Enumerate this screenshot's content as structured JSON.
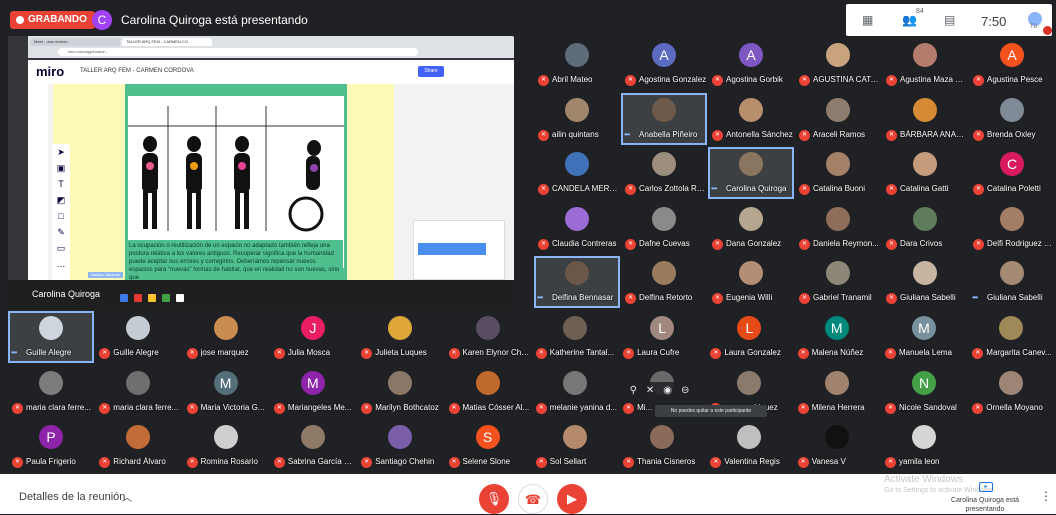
{
  "topbar": {
    "recording": "GRABANDO",
    "presenter_initial": "C",
    "presenter_title": "Carolina Quiroga está presentando",
    "time": "7:50",
    "participant_count": "84",
    "you_label": "Tú"
  },
  "presentation": {
    "tabs": [
      "Meet - una reunión",
      "TALLER ARQ FEM - CARMEN CO"
    ],
    "url": "miro.com/app/board/...",
    "app_name": "miro",
    "board": "TALLER ARQ FEM - CARMEN CORDOVA",
    "share": "Share",
    "body": "La ocupación o reutilización de un espacio no adaptado también refleja una postura relativa a los valores antiguos. Recuperar significa que la humanidad puede aceptar sus errores y corregirlos. Deberíamos repensar nuevos espacios para \"nuevas\" formas de habitar, que en realidad no son nuevas, sino que",
    "cursor_label": "Natalia Valverde",
    "presenter_name": "Carolina Quiroga"
  },
  "participants": [
    {
      "name": "Abril Mateo",
      "type": "photo",
      "bg": "#5d6b7a"
    },
    {
      "name": "Agostina Gonzalez",
      "type": "avatar",
      "letter": "A",
      "color": "#5c6bc0"
    },
    {
      "name": "Agostina Gorbik",
      "type": "avatar",
      "letter": "A",
      "color": "#7e57c2"
    },
    {
      "name": "AGUSTINA CATA...",
      "type": "photo",
      "bg": "#c9a27e"
    },
    {
      "name": "Agustina Maza G...",
      "type": "photo",
      "bg": "#b47c6d"
    },
    {
      "name": "Agustina Pesce",
      "type": "avatar",
      "letter": "A",
      "color": "#f4511e"
    },
    {
      "name": "ailin quintans",
      "type": "photo",
      "bg": "#a0866a"
    },
    {
      "name": "Anabella Piñeiro",
      "type": "photo",
      "bg": "#6e5a4a",
      "highlight": true,
      "speaking": true
    },
    {
      "name": "Antonella Sánchez",
      "type": "photo",
      "bg": "#b78f6d"
    },
    {
      "name": "Araceli Ramos",
      "type": "photo",
      "bg": "#8e7d6e"
    },
    {
      "name": "BÁRBARA ANAB...",
      "type": "photo",
      "bg": "#d68a34"
    },
    {
      "name": "Brenda Oxley",
      "type": "photo",
      "bg": "#7f8a96"
    },
    {
      "name": "CANDELA MERC...",
      "type": "photo",
      "bg": "#3f72b8"
    },
    {
      "name": "Carlos Zottola Re...",
      "type": "photo",
      "bg": "#9d8d7d"
    },
    {
      "name": "Carolina Quiroga",
      "type": "photo",
      "bg": "#8a7660",
      "highlight": true,
      "speaking": true
    },
    {
      "name": "Catalina Buoni",
      "type": "photo",
      "bg": "#a38066"
    },
    {
      "name": "Catalina Gatti",
      "type": "photo",
      "bg": "#c49c7b"
    },
    {
      "name": "Catalina Poletti",
      "type": "avatar",
      "letter": "C",
      "color": "#d81b60"
    },
    {
      "name": "Claudia Contreras",
      "type": "photo",
      "bg": "#9b6bd6"
    },
    {
      "name": "Dafne Cuevas",
      "type": "photo",
      "bg": "#8a8a8a"
    },
    {
      "name": "Dana Gonzalez",
      "type": "photo",
      "bg": "#b7a68f"
    },
    {
      "name": "Daniela Reymon...",
      "type": "photo",
      "bg": "#8e6e5a"
    },
    {
      "name": "Dara Crivos",
      "type": "photo",
      "bg": "#5f7d5a"
    },
    {
      "name": "Delfi Rodriguez B...",
      "type": "photo",
      "bg": "#a37e64"
    },
    {
      "name": "Delfina Bennasar",
      "type": "photo",
      "bg": "#6b5648",
      "highlight": true,
      "speaking": true
    },
    {
      "name": "Delfina Retorto",
      "type": "photo",
      "bg": "#9a7b5e"
    },
    {
      "name": "Eugenia Willi",
      "type": "photo",
      "bg": "#b38d74"
    },
    {
      "name": "Gabriel Tranamil",
      "type": "photo",
      "bg": "#8c8779"
    },
    {
      "name": "Giuliana Sabelli",
      "type": "photo",
      "bg": "#c8b5a1"
    },
    {
      "name": "Giuliana Sabelli",
      "type": "photo",
      "bg": "#a48a73",
      "speaking": true
    },
    {
      "name": "Guille Alegre",
      "type": "photo",
      "bg": "#cfd5dc",
      "highlight": true,
      "speaking": true
    },
    {
      "name": "Guille Alegre",
      "type": "photo",
      "bg": "#c5cbd2"
    },
    {
      "name": "jose marquez",
      "type": "photo",
      "bg": "#c98d52"
    },
    {
      "name": "Julia Mosca",
      "type": "avatar",
      "letter": "J",
      "color": "#e91e63"
    },
    {
      "name": "Julieta Luques",
      "type": "photo",
      "bg": "#e0a63a"
    },
    {
      "name": "Karen Elynor Cho...",
      "type": "photo",
      "bg": "#5a4e66"
    },
    {
      "name": "Katherine Tantal...",
      "type": "photo",
      "bg": "#6e5f53"
    },
    {
      "name": "Laura Cufre",
      "type": "avatar",
      "letter": "L",
      "color": "#a1887f"
    },
    {
      "name": "Laura Gonzalez",
      "type": "avatar",
      "letter": "L",
      "color": "#e64a19"
    },
    {
      "name": "Malena Núñez",
      "type": "avatar",
      "letter": "M",
      "color": "#00897b"
    },
    {
      "name": "Manuela Lema",
      "type": "avatar",
      "letter": "M",
      "color": "#78909c"
    },
    {
      "name": "Margarita Canev...",
      "type": "photo",
      "bg": "#9d8a58"
    },
    {
      "name": "maria clara ferre...",
      "type": "photo",
      "bg": "#7c7c7c"
    },
    {
      "name": "maria clara ferre...",
      "type": "photo",
      "bg": "#6f6f6f"
    },
    {
      "name": "Maria Victoria G...",
      "type": "avatar",
      "letter": "M",
      "color": "#546e7a"
    },
    {
      "name": "Mariangeles Me...",
      "type": "avatar",
      "letter": "M",
      "color": "#8e24aa"
    },
    {
      "name": "Marilyn Bothcatoz",
      "type": "photo",
      "bg": "#8b7766"
    },
    {
      "name": "Matias Cósser Al...",
      "type": "photo",
      "bg": "#c0692c"
    },
    {
      "name": "melanie yanina d...",
      "type": "photo",
      "bg": "#777"
    },
    {
      "name": "Mi...",
      "type": "photo",
      "bg": "#6a6a6a"
    },
    {
      "name": "...ros rodriguez",
      "type": "photo",
      "bg": "#8a7a6c"
    },
    {
      "name": "Milena Herrera",
      "type": "photo",
      "bg": "#a1826c"
    },
    {
      "name": "Nicole Sandoval",
      "type": "avatar",
      "letter": "N",
      "color": "#43a047"
    },
    {
      "name": "Ornella Moyano",
      "type": "photo",
      "bg": "#9c8574"
    },
    {
      "name": "Paula Frigerio",
      "type": "avatar",
      "letter": "P",
      "color": "#8e24aa"
    },
    {
      "name": "Richard Álvaro",
      "type": "photo",
      "bg": "#c46c38"
    },
    {
      "name": "Romina Rosario",
      "type": "photo",
      "bg": "#cfcfcf"
    },
    {
      "name": "Sabrina García S...",
      "type": "photo",
      "bg": "#8f7a67"
    },
    {
      "name": "Santiago Chehin",
      "type": "photo",
      "bg": "#7a5ea8"
    },
    {
      "name": "Selene Slone",
      "type": "avatar",
      "letter": "S",
      "color": "#f4511e"
    },
    {
      "name": "Sol Sellart",
      "type": "photo",
      "bg": "#b58a6c"
    },
    {
      "name": "Thania Cisneros",
      "type": "photo",
      "bg": "#8a6b59"
    },
    {
      "name": "Valentina Regis",
      "type": "photo",
      "bg": "#bfbfbf"
    },
    {
      "name": "Vanesa V",
      "type": "photo",
      "bg": "#111"
    },
    {
      "name": "yamila leon",
      "type": "photo",
      "bg": "#d6d6d6"
    }
  ],
  "hover": {
    "tooltip": "No puedes quitar a este participante"
  },
  "bottom": {
    "details": "Detalles de la reunión",
    "activate_title": "Activate Windows",
    "activate_sub": "Go to Settings to activate Windows.",
    "presenting_status": "Carolina Quiroga está presentando"
  }
}
